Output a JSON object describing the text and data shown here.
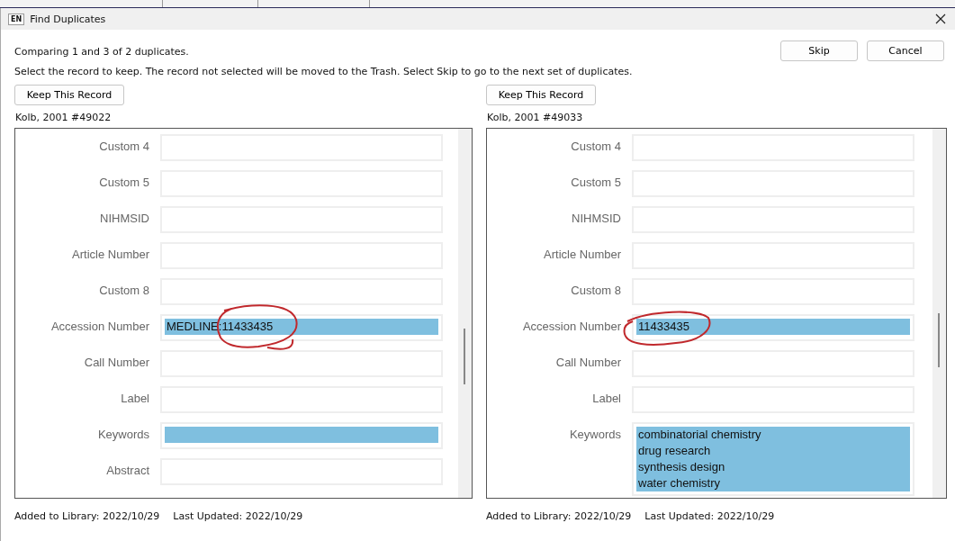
{
  "window": {
    "app_badge": "EN",
    "title": "Find Duplicates"
  },
  "status": "Comparing 1 and 3 of 2 duplicates.",
  "instruction": "Select the record to keep. The record not selected will be moved to the Trash. Select Skip to go to the next set of duplicates.",
  "buttons": [
    "Skip",
    "Cancel"
  ],
  "records": [
    {
      "keep_button": "Keep This Record",
      "record_id": "Kolb, 2001 #49022",
      "fields": [
        {
          "label": "Custom 4"
        },
        {
          "label": "Custom 5"
        },
        {
          "label": "NIHMSID"
        },
        {
          "label": "Article Number"
        },
        {
          "label": "Custom 8"
        },
        {
          "label": "Accession Number",
          "lines": [
            "MEDLINE:11433435"
          ],
          "highlighted": true,
          "annotated": true
        },
        {
          "label": "Call Number"
        },
        {
          "label": "Label"
        },
        {
          "label": "Keywords",
          "highlighted": true
        },
        {
          "label": "Abstract"
        }
      ],
      "added": "Added to Library: 2022/10/29",
      "updated": "Last Updated: 2022/10/29"
    },
    {
      "keep_button": "Keep This Record",
      "record_id": "Kolb, 2001 #49033",
      "fields": [
        {
          "label": "Custom 4"
        },
        {
          "label": "Custom 5"
        },
        {
          "label": "NIHMSID"
        },
        {
          "label": "Article Number"
        },
        {
          "label": "Custom 8"
        },
        {
          "label": "Accession Number",
          "lines": [
            "11433435"
          ],
          "highlighted": true,
          "annotated": true
        },
        {
          "label": "Call Number"
        },
        {
          "label": "Label"
        },
        {
          "label": "Keywords",
          "lines": [
            "combinatorial chemistry",
            "drug research",
            "synthesis design",
            "water chemistry"
          ],
          "highlighted": true
        }
      ],
      "added": "Added to Library: 2022/10/29",
      "updated": "Last Updated: 2022/10/29"
    }
  ]
}
